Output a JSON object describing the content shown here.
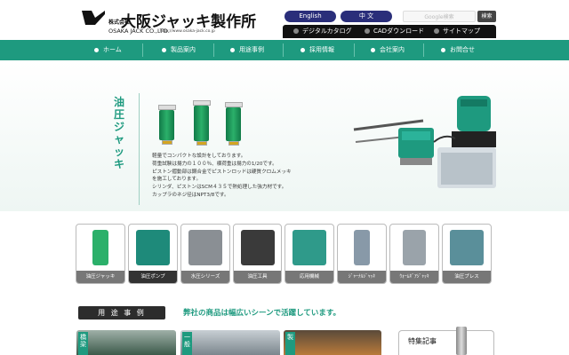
{
  "header": {
    "logo_text": "大阪ジャッキ製作所",
    "logo_small": "株式会社",
    "logo_en": "OSAKA JACK CO.,LTD.",
    "logo_url": "http://www.osaka-jack.co.jp",
    "lang_en": "English",
    "lang_zh": "中 文",
    "search_placeholder": "Google検索",
    "search_button": "検索",
    "sublinks": [
      "デジタルカタログ",
      "CADダウンロード",
      "サイトマップ"
    ]
  },
  "nav": {
    "items": [
      "ホーム",
      "製品案内",
      "用途事例",
      "採用情報",
      "会社案内",
      "お問合せ"
    ]
  },
  "hero": {
    "title": "油圧ジャッキ",
    "description": [
      "軽量でコンパクトな設計をしております。",
      "荷重試験は揚力の１００％、横荷重は揚力の1/20です。",
      "ピストン摺動部は鋼合金でピストンロッドは硬質クロムメッキ",
      "を施工しております。",
      "シリンダ、ピストンはSCM４３５で熱処理した強力材です。",
      "カップラのネジ径はNPT3/8です。"
    ]
  },
  "products": {
    "items": [
      {
        "label": "油圧ジャッキ",
        "color": "#2bb06a"
      },
      {
        "label": "油圧ポンプ",
        "color": "#1e8a7a"
      },
      {
        "label": "水圧シリーズ",
        "color": "#8a8f94"
      },
      {
        "label": "油圧工具",
        "color": "#3a3a3a"
      },
      {
        "label": "応用機械",
        "color": "#2f9a8a"
      },
      {
        "label": "ｼﾞｬｰﾅﾙｼﾞｬｯｷ",
        "color": "#8899a8"
      },
      {
        "label": "ｳｫｰﾑｷﾞｱｼﾞｬｯｷ",
        "color": "#9aa3aa"
      },
      {
        "label": "油圧プレス",
        "color": "#5a8f9a"
      }
    ]
  },
  "usage": {
    "label": "用 途 事 例",
    "text": "弊社の商品は幅広いシーンで活躍しています。",
    "cards": [
      "橋梁",
      "一般",
      "製"
    ]
  },
  "feature": {
    "label": "特集記事"
  },
  "colors": {
    "brand_green": "#1e9a7f",
    "lang_button": "#2a2e7a",
    "dark": "#111111"
  }
}
